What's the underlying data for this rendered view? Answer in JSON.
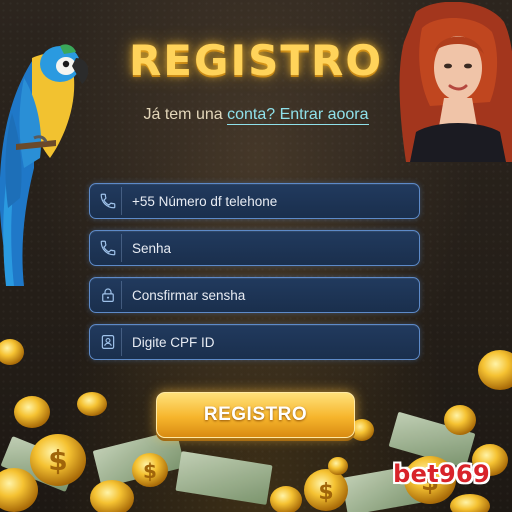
{
  "header": {
    "title": "REGISTRO",
    "subtitle_plain": "Já tem una ",
    "subtitle_link": "conta? Entrar aoora"
  },
  "form": {
    "fields": [
      {
        "label": "+55 Número df telehone",
        "icon": "phone-icon"
      },
      {
        "label": "Senha",
        "icon": "phone-icon"
      },
      {
        "label": "Consfirmar sensha",
        "icon": "lock-icon"
      },
      {
        "label": "Digite CPF ID",
        "icon": "id-card-icon"
      }
    ],
    "submit_label": "REGISTRO"
  },
  "brand": {
    "logo_text": "bet969"
  },
  "colors": {
    "title_gold": "#ffd35a",
    "link_cyan": "#8fe0ea",
    "field_border": "#5d8ac8",
    "field_bg": "#1a2f4d",
    "button_gold": "#f6b52c",
    "brand_red": "#d8232a"
  }
}
